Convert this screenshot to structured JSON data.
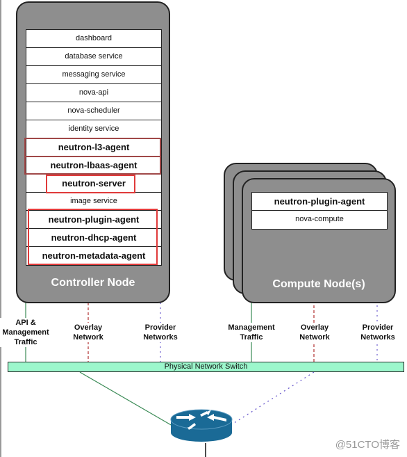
{
  "controller": {
    "title": "Controller Node",
    "services": [
      {
        "label": "dashboard",
        "bold": false
      },
      {
        "label": "database service",
        "bold": false
      },
      {
        "label": "messaging service",
        "bold": false
      },
      {
        "label": "nova-api",
        "bold": false
      },
      {
        "label": "nova-scheduler",
        "bold": false
      },
      {
        "label": "identity service",
        "bold": false
      },
      {
        "label": "neutron-l3-agent",
        "bold": true
      },
      {
        "label": "neutron-lbaas-agent",
        "bold": true
      },
      {
        "label": "neutron-server",
        "bold": true
      },
      {
        "label": "image service",
        "bold": false
      },
      {
        "label": "neutron-plugin-agent",
        "bold": true
      },
      {
        "label": "neutron-dhcp-agent",
        "bold": true
      },
      {
        "label": "neutron-metadata-agent",
        "bold": true
      }
    ],
    "networks": {
      "api": "API &\nManagement\nTraffic",
      "overlay": "Overlay\nNetwork",
      "provider": "Provider\nNetworks"
    }
  },
  "compute": {
    "title": "Compute Node(s)",
    "services": [
      {
        "label": "neutron-plugin-agent",
        "bold": true
      },
      {
        "label": "nova-compute",
        "bold": false
      }
    ],
    "networks": {
      "management": "Management\nTraffic",
      "overlay": "Overlay\nNetwork",
      "provider": "Provider\nNetworks"
    }
  },
  "switch": {
    "label": "Physical Network Switch"
  },
  "router": {
    "icon": "router-icon"
  },
  "colors": {
    "management_line": "#3a8a55",
    "overlay_line": "#b03030",
    "provider_line": "#6a5acd",
    "highlight": "#e03a3a",
    "switch_fill": "#9cf7cc",
    "router_fill": "#1a6a96"
  },
  "watermark": "@51CTO博客"
}
